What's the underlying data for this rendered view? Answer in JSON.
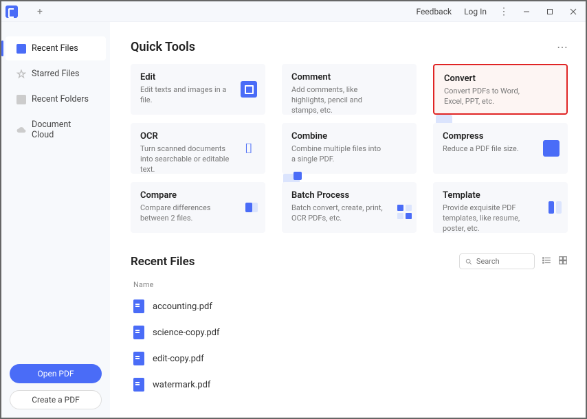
{
  "titlebar": {
    "feedback": "Feedback",
    "login": "Log In"
  },
  "sidebar": {
    "items": [
      {
        "label": "Recent Files",
        "active": true
      },
      {
        "label": "Starred Files"
      },
      {
        "label": "Recent Folders"
      },
      {
        "label": "Document Cloud"
      }
    ],
    "open_pdf": "Open PDF",
    "create_pdf": "Create a PDF"
  },
  "quick_tools": {
    "heading": "Quick Tools",
    "tools": [
      {
        "title": "Edit",
        "desc": "Edit texts and images in a file."
      },
      {
        "title": "Comment",
        "desc": "Add comments, like highlights, pencil and stamps, etc."
      },
      {
        "title": "Convert",
        "desc": "Convert PDFs to Word, Excel, PPT, etc.",
        "highlighted": true
      },
      {
        "title": "OCR",
        "desc": "Turn scanned documents into searchable or editable text."
      },
      {
        "title": "Combine",
        "desc": "Combine multiple files into a single PDF."
      },
      {
        "title": "Compress",
        "desc": "Reduce a PDF file size."
      },
      {
        "title": "Compare",
        "desc": "Compare differences between 2 files."
      },
      {
        "title": "Batch Process",
        "desc": "Batch convert, create, print, OCR PDFs, etc."
      },
      {
        "title": "Template",
        "desc": "Provide exquisite PDF templates, like resume, poster, etc."
      }
    ]
  },
  "recent_files": {
    "heading": "Recent Files",
    "search_placeholder": "Search",
    "col_name": "Name",
    "files": [
      {
        "name": "accounting.pdf"
      },
      {
        "name": "science-copy.pdf"
      },
      {
        "name": "edit-copy.pdf"
      },
      {
        "name": "watermark.pdf"
      }
    ]
  }
}
